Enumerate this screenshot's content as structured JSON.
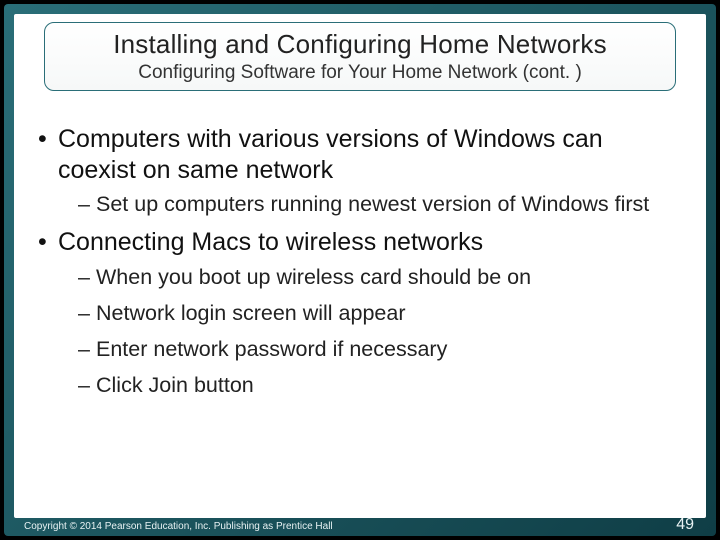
{
  "header": {
    "title": "Installing and Configuring Home Networks",
    "subtitle": "Configuring Software for Your Home Network (cont. )"
  },
  "bullets": {
    "b1": "Computers with various versions of Windows can coexist on same network",
    "b1_sub1": "Set up computers running newest version of Windows first",
    "b2": "Connecting Macs to wireless networks",
    "b2_sub1": "When you boot up wireless card should be on",
    "b2_sub2": "Network login screen will appear",
    "b2_sub3": "Enter network password if necessary",
    "b2_sub4": "Click Join button"
  },
  "footer": {
    "copyright": "Copyright © 2014 Pearson Education, Inc. Publishing as Prentice Hall",
    "page": "49"
  }
}
